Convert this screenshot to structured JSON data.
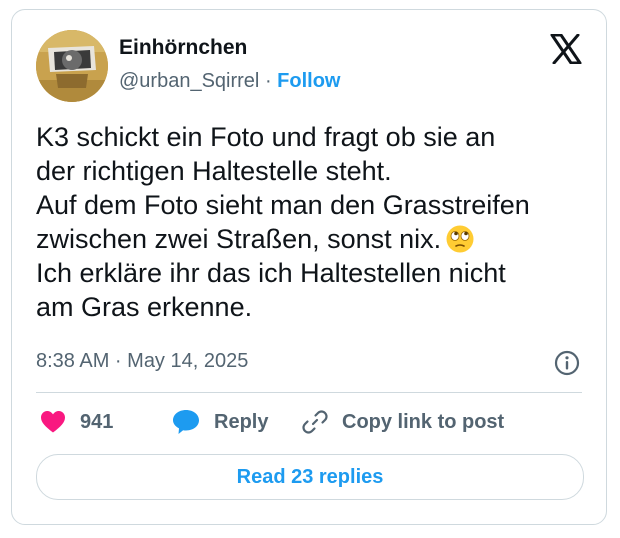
{
  "user": {
    "display_name": "Einhörnchen",
    "handle": "@urban_Sqirrel",
    "separator": "·",
    "follow_label": "Follow"
  },
  "tweet": {
    "text": "K3 schickt ein Foto und fragt ob sie an\nder richtigen Haltestelle steht.\nAuf dem Foto sieht man den Grasstreifen\nzwischen zwei Straßen, sonst nix.",
    "text_after_emoji": "\nIch erkläre ihr das ich Haltestellen nicht\nam Gras erkenne.",
    "emoji": "face-with-rolling-eyes",
    "timestamp": "8:38 AM · May 14, 2025"
  },
  "actions": {
    "likes_count": "941",
    "reply_label": "Reply",
    "copy_link_label": "Copy link to post"
  },
  "footer": {
    "read_replies_label": "Read 23 replies"
  },
  "icons": {
    "brand": "x-logo-icon",
    "info": "info-icon",
    "like": "heart-icon",
    "reply": "speech-bubble-icon",
    "copy_link": "link-icon"
  },
  "colors": {
    "accent": "#1d9bf0",
    "like": "#f91880",
    "text": "#0f1419",
    "secondary": "#536471",
    "border": "#cfd9de"
  }
}
